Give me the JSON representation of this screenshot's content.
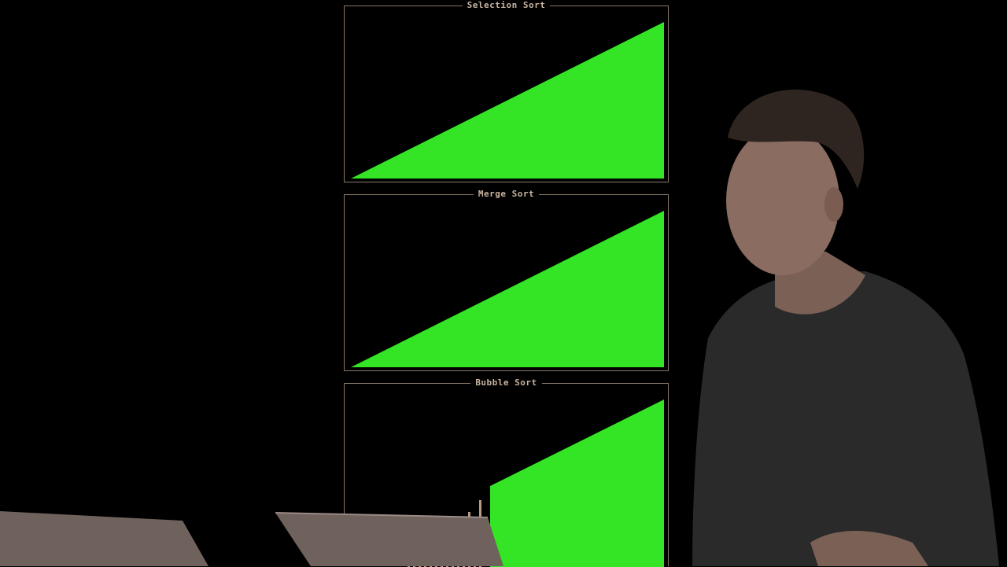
{
  "panels": [
    {
      "title": "Selection Sort",
      "state": "sorted",
      "progress": 1.0
    },
    {
      "title": "Merge Sort",
      "state": "sorted",
      "progress": 1.0
    },
    {
      "title": "Bubble Sort",
      "state": "partially-sorted",
      "progress": 0.55
    }
  ],
  "colors": {
    "background": "#000000",
    "sorted_bar": "#34e526",
    "unsorted_bar": "#b89a8a",
    "frame": "#8a7a6a",
    "title": "#c8b4a0"
  },
  "scene": {
    "presenter": "person-speaking",
    "laptops": [
      "laptop-left",
      "laptop-center"
    ]
  }
}
